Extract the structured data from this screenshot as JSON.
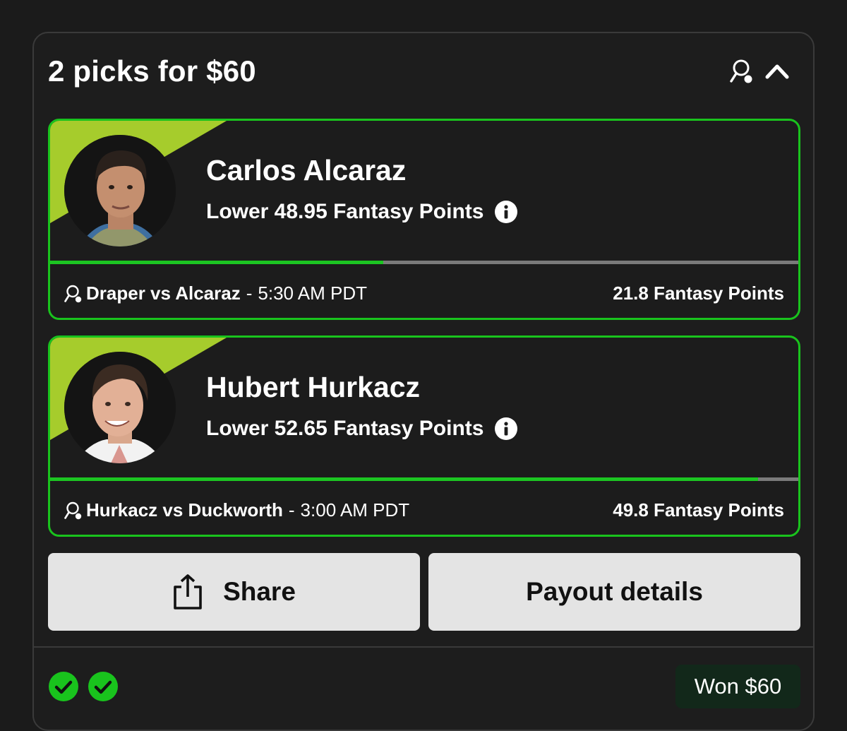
{
  "entry": {
    "title": "2 picks for $60",
    "accent_color": "#a6cc2c",
    "win_color": "#19c31d",
    "header_icons": [
      "tennis-sport-icon",
      "chevron-up-icon"
    ]
  },
  "picks": [
    {
      "player": "Carlos Alcaraz",
      "projection": "Lower 48.95 Fantasy Points",
      "match": "Draper vs Alcaraz",
      "separator": "-",
      "time": "5:30 AM PDT",
      "result": "21.8 Fantasy Points",
      "progress_fraction": 0.445,
      "status": "won"
    },
    {
      "player": "Hubert Hurkacz",
      "projection": "Lower 52.65 Fantasy Points",
      "match": "Hurkacz vs Duckworth",
      "separator": "-",
      "time": "3:00 AM PDT",
      "result": "49.8 Fantasy Points",
      "progress_fraction": 0.946,
      "status": "won"
    }
  ],
  "actions": {
    "share_label": "Share",
    "payout_label": "Payout details"
  },
  "footer": {
    "result_badge": "Won $60",
    "check_count": 2
  }
}
